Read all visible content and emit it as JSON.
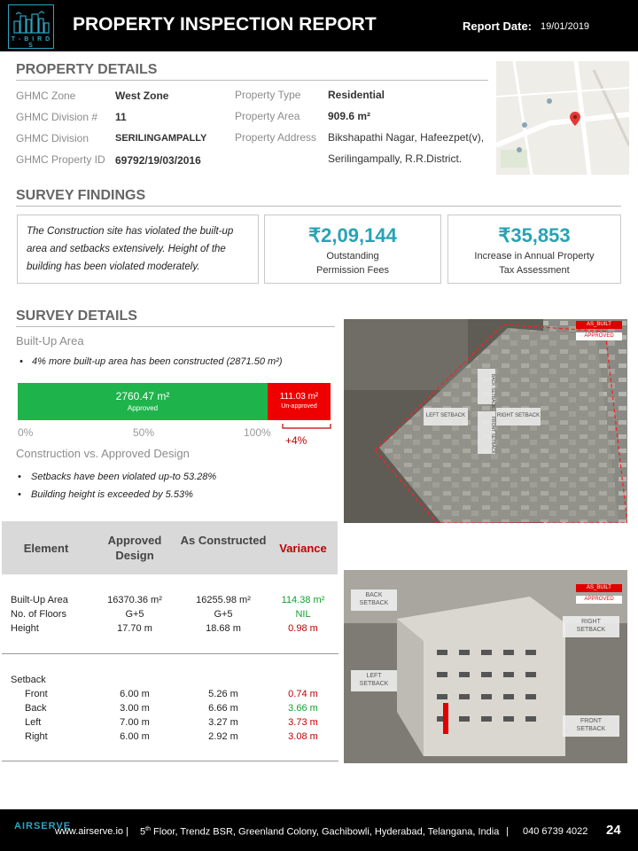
{
  "header": {
    "logo_text": "T - B I R D S",
    "title": "PROPERTY INSPECTION REPORT",
    "report_date_label": "Report Date:",
    "report_date": "19/01/2019"
  },
  "property_details": {
    "heading": "PROPERTY DETAILS",
    "left": [
      {
        "label": "GHMC Zone",
        "value": "West Zone"
      },
      {
        "label": "GHMC Division  #",
        "value": "11"
      },
      {
        "label": "GHMC Division",
        "value": "SERILINGAMPALLY"
      },
      {
        "label": "GHMC Property ID",
        "value": "69792/19/03/2016"
      }
    ],
    "right": [
      {
        "label": "Property Type",
        "value": "Residential"
      },
      {
        "label": "Property Area",
        "value": "909.6 m²"
      },
      {
        "label": "Property Address",
        "value": "Bikshapathi Nagar, Hafeezpet(v),"
      },
      {
        "label": "",
        "value": "Serilingampally, R.R.District."
      }
    ]
  },
  "survey_findings": {
    "heading": "SURVEY FINDINGS",
    "text": "The Construction site has violated the built-up area and setbacks extensively.  Height of the building has been violated moderately.",
    "fees_amount": "₹2,09,144",
    "fees_caption_1": "Outstanding",
    "fees_caption_2": "Permission Fees",
    "tax_amount": "₹35,853",
    "tax_caption_1": "Increase in Annual Property",
    "tax_caption_2": "Tax Assessment"
  },
  "survey_details": {
    "heading": "SURVEY DETAILS",
    "builtup_heading": "Built-Up  Area",
    "builtup_bullet": "4% more built-up area has been constructed  (2871.50 m²)",
    "bar": {
      "approved_fraction": 0.8,
      "approved_value": "2760.47  m²",
      "approved_label": "Approved",
      "unapproved_value": "111.03 m²",
      "unapproved_label": "Un-approved",
      "tick_0": "0%",
      "tick_50": "50%",
      "tick_100": "100%",
      "extra": "+4%"
    },
    "construction_heading": "Construction  vs. Approved Design",
    "bullets": [
      "Setbacks have been violated up-to 53.28%",
      "Building height is exceeded by 5.53%"
    ]
  },
  "table": {
    "headers": [
      "Element",
      "Approved Design",
      "As Constructed",
      "Variance"
    ],
    "group1": [
      {
        "element": "Built-Up Area",
        "approved": "16370.36 m²",
        "constructed": "16255.98 m²",
        "variance": "114.38 m²",
        "color": "green"
      },
      {
        "element": "No. of Floors",
        "approved": "G+5",
        "constructed": "G+5",
        "variance": "NIL",
        "color": "green"
      },
      {
        "element": "Height",
        "approved": "17.70 m",
        "constructed": "18.68 m",
        "variance": "0.98 m",
        "color": "red"
      }
    ],
    "group2_title": "Setback",
    "group2": [
      {
        "element": "Front",
        "approved": "6.00 m",
        "constructed": "5.26 m",
        "variance": "0.74 m",
        "color": "red"
      },
      {
        "element": "Back",
        "approved": "3.00 m",
        "constructed": "6.66 m",
        "variance": "3.66 m",
        "color": "green"
      },
      {
        "element": "Left",
        "approved": "7.00 m",
        "constructed": "3.27 m",
        "variance": "3.73 m",
        "color": "red"
      },
      {
        "element": "Right",
        "approved": "6.00 m",
        "constructed": "2.92 m",
        "variance": "3.08 m",
        "color": "red"
      }
    ]
  },
  "photo1": {
    "legend_as_built": "AS_BUILT",
    "legend_approved": "APPROVED",
    "back_setback": "BACK SETBACK",
    "left_setback": "LEFT SETBACK",
    "right_setback": "RIGHT SETBACK",
    "front_setback": "FRONT SETBACK"
  },
  "photo2": {
    "legend_as_built": "AS_BUILT",
    "legend_approved": "APPROVED",
    "back_setback_1": "BACK",
    "back_setback_2": "SETBACK",
    "right_setback_1": "RIGHT",
    "right_setback_2": "SETBACK",
    "left_setback_1": "LEFT",
    "left_setback_2": "SETBACK",
    "front_setback_1": "FRONT",
    "front_setback_2": "SETBACK"
  },
  "footer": {
    "brand": "AIRSERVE",
    "website": "www.airserve.io  |",
    "floor_sup": "th",
    "address_prefix": "5",
    "address": "Floor, Trendz BSR, Greenland Colony, Gachibowli, Hyderabad, Telangana, India",
    "sep": "|",
    "phone": "040 6739 4022",
    "page": "24"
  },
  "colors": {
    "header_bg": "#000000",
    "accent": "#27a3b5",
    "approved_green": "#1fb34c",
    "unapproved_red": "#ee0000",
    "variance_red": "#c00000",
    "variance_green": "#11a02e"
  }
}
